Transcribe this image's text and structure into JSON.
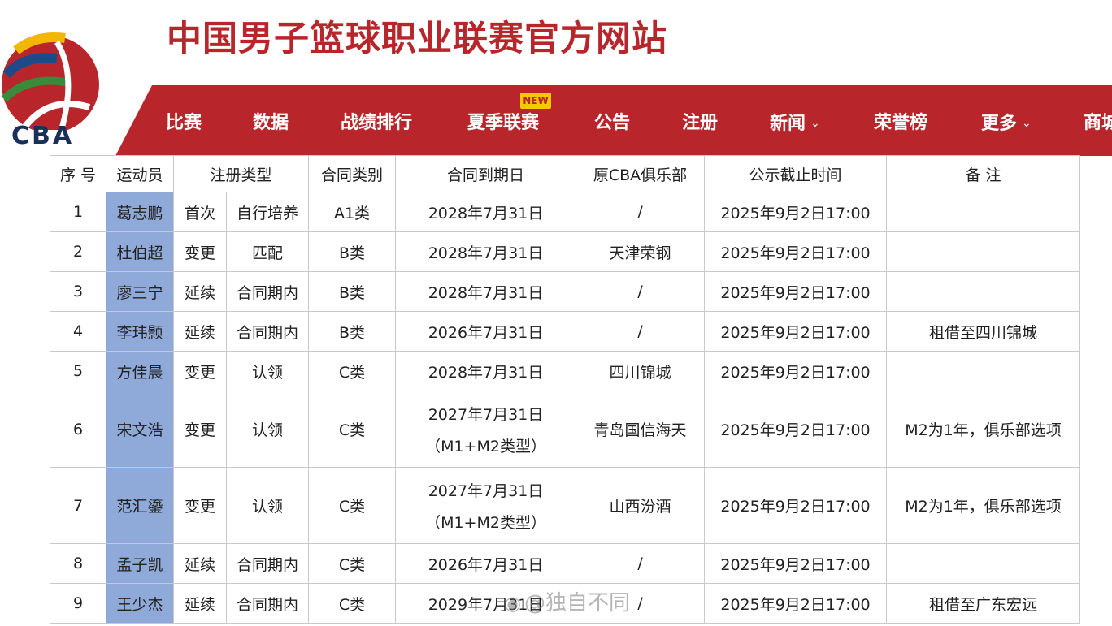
{
  "header": {
    "logo_text": "CBA",
    "site_title": "中国男子篮球职业联赛官方网站",
    "brand_color": "#b8262b"
  },
  "nav": {
    "items": [
      {
        "label": "比赛"
      },
      {
        "label": "数据"
      },
      {
        "label": "战绩排行"
      },
      {
        "label": "夏季联赛"
      },
      {
        "label": "公告"
      },
      {
        "label": "注册"
      },
      {
        "label": "新闻"
      },
      {
        "label": "荣誉榜"
      },
      {
        "label": "更多"
      },
      {
        "label": "商城"
      }
    ],
    "new_badge": "NEW",
    "dropdown_icon": "chevron-down-icon"
  },
  "table": {
    "headers": {
      "index": "序 号",
      "player": "运动员",
      "reg_type": "注册类型",
      "contract_class": "合同类别",
      "expiry": "合同到期日",
      "former_club": "原CBA俱乐部",
      "deadline": "公示截止时间",
      "remarks": "备 注"
    },
    "rows": [
      {
        "index": "1",
        "player": "葛志鹏",
        "reg_type": "首次",
        "reg_sub": "自行培养",
        "contract_class": "A1类",
        "expiry": "2028年7月31日",
        "expiry_note": "",
        "former_club": "/",
        "deadline": "2025年9月2日17:00",
        "remarks": ""
      },
      {
        "index": "2",
        "player": "杜伯超",
        "reg_type": "变更",
        "reg_sub": "匹配",
        "contract_class": "B类",
        "expiry": "2028年7月31日",
        "expiry_note": "",
        "former_club": "天津荣钢",
        "deadline": "2025年9月2日17:00",
        "remarks": ""
      },
      {
        "index": "3",
        "player": "廖三宁",
        "reg_type": "延续",
        "reg_sub": "合同期内",
        "contract_class": "B类",
        "expiry": "2028年7月31日",
        "expiry_note": "",
        "former_club": "/",
        "deadline": "2025年9月2日17:00",
        "remarks": ""
      },
      {
        "index": "4",
        "player": "李玮颢",
        "reg_type": "延续",
        "reg_sub": "合同期内",
        "contract_class": "B类",
        "expiry": "2026年7月31日",
        "expiry_note": "",
        "former_club": "/",
        "deadline": "2025年9月2日17:00",
        "remarks": "租借至四川锦城"
      },
      {
        "index": "5",
        "player": "方佳晨",
        "reg_type": "变更",
        "reg_sub": "认领",
        "contract_class": "C类",
        "expiry": "2028年7月31日",
        "expiry_note": "",
        "former_club": "四川锦城",
        "deadline": "2025年9月2日17:00",
        "remarks": ""
      },
      {
        "index": "6",
        "player": "宋文浩",
        "reg_type": "变更",
        "reg_sub": "认领",
        "contract_class": "C类",
        "expiry": "2027年7月31日",
        "expiry_note": "（M1+M2类型）",
        "former_club": "青岛国信海天",
        "deadline": "2025年9月2日17:00",
        "remarks": "M2为1年，俱乐部选项"
      },
      {
        "index": "7",
        "player": "范汇鎏",
        "reg_type": "变更",
        "reg_sub": "认领",
        "contract_class": "C类",
        "expiry": "2027年7月31日",
        "expiry_note": "（M1+M2类型）",
        "former_club": "山西汾酒",
        "deadline": "2025年9月2日17:00",
        "remarks": "M2为1年，俱乐部选项"
      },
      {
        "index": "8",
        "player": "孟子凯",
        "reg_type": "延续",
        "reg_sub": "合同期内",
        "contract_class": "C类",
        "expiry": "2026年7月31日",
        "expiry_note": "",
        "former_club": "/",
        "deadline": "2025年9月2日17:00",
        "remarks": ""
      },
      {
        "index": "9",
        "player": "王少杰",
        "reg_type": "延续",
        "reg_sub": "合同期内",
        "contract_class": "C类",
        "expiry": "2029年7月31日",
        "expiry_note": "",
        "former_club": "/",
        "deadline": "2025年9月2日17:00",
        "remarks": "租借至广东宏远"
      }
    ]
  },
  "watermark": "@独自不同"
}
